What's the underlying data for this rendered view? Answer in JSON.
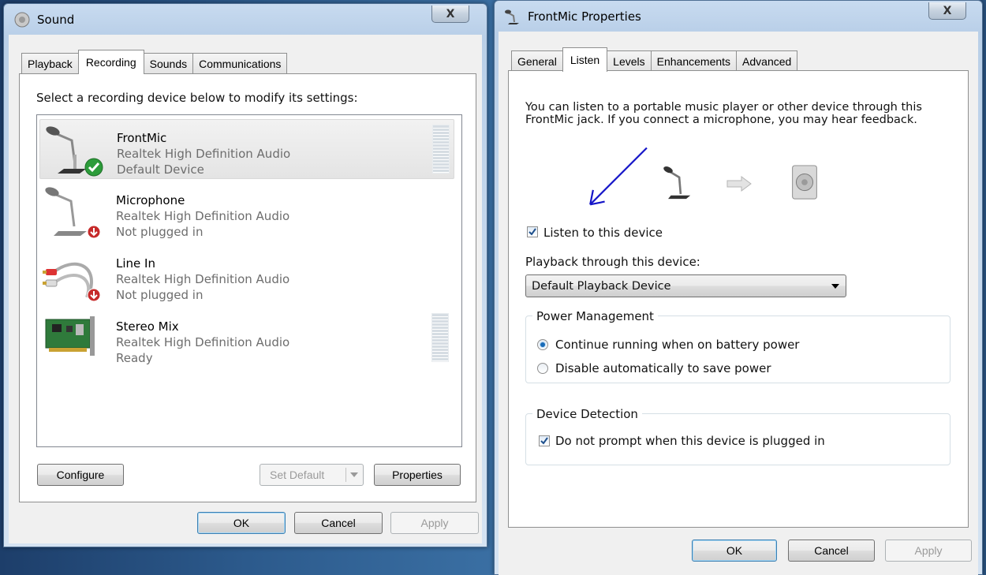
{
  "colors": {
    "desktop": "#2c5a8c",
    "window_frame": "#b9cfe8",
    "selection_bg": "#e4e4e4",
    "muted_text": "#6d6d6d",
    "annotation_arrow": "#1515c8"
  },
  "sound_window": {
    "title": "Sound",
    "close_label": "X",
    "tabs": [
      "Playback",
      "Recording",
      "Sounds",
      "Communications"
    ],
    "active_tab": "Recording",
    "instructions": "Select a recording device below to modify its settings:",
    "devices": [
      {
        "name": "FrontMic",
        "driver": "Realtek High Definition Audio",
        "status": "Default Device",
        "icon": "microphone-icon",
        "badge": "default-check-icon",
        "selected": true
      },
      {
        "name": "Microphone",
        "driver": "Realtek High Definition Audio",
        "status": "Not plugged in",
        "icon": "microphone-icon",
        "badge": "unplugged-arrow-icon",
        "selected": false
      },
      {
        "name": "Line In",
        "driver": "Realtek High Definition Audio",
        "status": "Not plugged in",
        "icon": "rca-cable-icon",
        "badge": "unplugged-arrow-icon",
        "selected": false
      },
      {
        "name": "Stereo Mix",
        "driver": "Realtek High Definition Audio",
        "status": "Ready",
        "icon": "sound-card-icon",
        "badge": "",
        "selected": false
      }
    ],
    "buttons": {
      "configure": "Configure",
      "set_default": "Set Default",
      "properties": "Properties",
      "ok": "OK",
      "cancel": "Cancel",
      "apply": "Apply"
    }
  },
  "properties_window": {
    "title": "FrontMic Properties",
    "close_label": "X",
    "tabs": [
      "General",
      "Listen",
      "Levels",
      "Enhancements",
      "Advanced"
    ],
    "active_tab": "Listen",
    "description": "You can listen to a portable music player or other device through this FrontMic jack.  If you connect a microphone, you may hear feedback.",
    "listen_checkbox": {
      "label": "Listen to this device",
      "checked": true
    },
    "playback_label": "Playback through this device:",
    "playback_selected": "Default Playback Device",
    "power_group": {
      "title": "Power Management",
      "options": [
        {
          "label": "Continue running when on battery power",
          "selected": true
        },
        {
          "label": "Disable automatically to save power",
          "selected": false
        }
      ]
    },
    "detection_group": {
      "title": "Device Detection",
      "checkbox": {
        "label": "Do not prompt when this device is plugged in",
        "checked": true
      }
    },
    "buttons": {
      "ok": "OK",
      "cancel": "Cancel",
      "apply": "Apply"
    }
  }
}
